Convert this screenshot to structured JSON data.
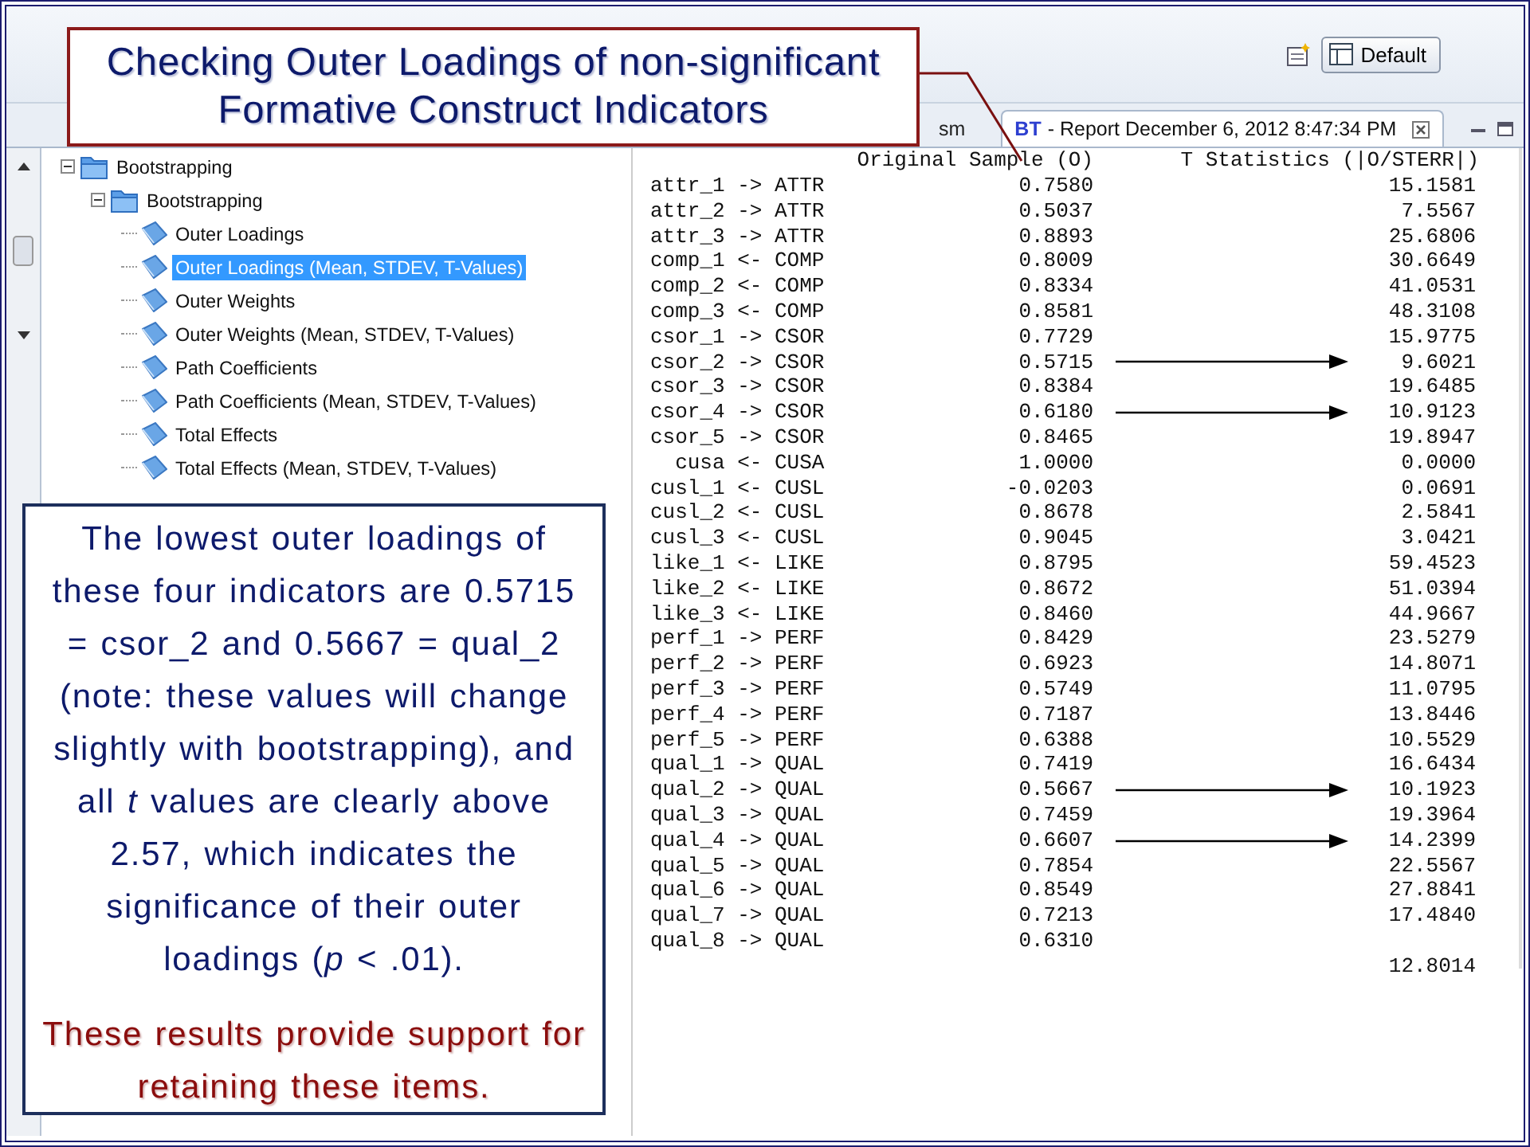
{
  "toolbar": {
    "perspective_button": "Default"
  },
  "tabs": [
    {
      "label": "sm",
      "selected": false
    },
    {
      "icon_label": "BT",
      "label": "- Report December 6, 2012 8:47:34 PM",
      "selected": true
    }
  ],
  "tree": [
    {
      "label": "Bootstrapping",
      "expanded": true,
      "selected": false,
      "children": [
        {
          "label": "Bootstrapping",
          "expanded": true,
          "selected": false,
          "children": [
            {
              "label": "Outer Loadings",
              "selected": false
            },
            {
              "label": "Outer Loadings (Mean, STDEV, T-Values)",
              "selected": true
            },
            {
              "label": "Outer Weights",
              "selected": false
            },
            {
              "label": "Outer Weights (Mean, STDEV, T-Values)",
              "selected": false
            },
            {
              "label": "Path Coefficients",
              "selected": false
            },
            {
              "label": "Path Coefficients (Mean, STDEV, T-Values)",
              "selected": false
            },
            {
              "label": "Total Effects",
              "selected": false
            },
            {
              "label": "Total Effects (Mean, STDEV, T-Values)",
              "selected": false
            }
          ]
        }
      ]
    }
  ],
  "report": {
    "columns": [
      "Original Sample (O)",
      "T Statistics (|O/STERR|)"
    ],
    "rows": [
      {
        "indicator": "attr_1",
        "direction": "->",
        "construct": "ATTR",
        "original_sample": "0.7580",
        "t_statistic": "15.1581",
        "arrow": false
      },
      {
        "indicator": "attr_2",
        "direction": "->",
        "construct": "ATTR",
        "original_sample": "0.5037",
        "t_statistic": "7.5567",
        "arrow": false
      },
      {
        "indicator": "attr_3",
        "direction": "->",
        "construct": "ATTR",
        "original_sample": "0.8893",
        "t_statistic": "25.6806",
        "arrow": false
      },
      {
        "indicator": "comp_1",
        "direction": "<-",
        "construct": "COMP",
        "original_sample": "0.8009",
        "t_statistic": "30.6649",
        "arrow": false
      },
      {
        "indicator": "comp_2",
        "direction": "<-",
        "construct": "COMP",
        "original_sample": "0.8334",
        "t_statistic": "41.0531",
        "arrow": false
      },
      {
        "indicator": "comp_3",
        "direction": "<-",
        "construct": "COMP",
        "original_sample": "0.8581",
        "t_statistic": "48.3108",
        "arrow": false
      },
      {
        "indicator": "csor_1",
        "direction": "->",
        "construct": "CSOR",
        "original_sample": "0.7729",
        "t_statistic": "15.9775",
        "arrow": false
      },
      {
        "indicator": "csor_2",
        "direction": "->",
        "construct": "CSOR",
        "original_sample": "0.5715",
        "t_statistic": "9.6021",
        "arrow": true
      },
      {
        "indicator": "csor_3",
        "direction": "->",
        "construct": "CSOR",
        "original_sample": "0.8384",
        "t_statistic": "19.6485",
        "arrow": false
      },
      {
        "indicator": "csor_4",
        "direction": "->",
        "construct": "CSOR",
        "original_sample": "0.6180",
        "t_statistic": "10.9123",
        "arrow": true
      },
      {
        "indicator": "csor_5",
        "direction": "->",
        "construct": "CSOR",
        "original_sample": "0.8465",
        "t_statistic": "19.8947",
        "arrow": false
      },
      {
        "indicator": "cusa",
        "direction": "<-",
        "construct": "CUSA",
        "original_sample": "1.0000",
        "t_statistic": "0.0000",
        "arrow": false
      },
      {
        "indicator": "cusl_1",
        "direction": "<-",
        "construct": "CUSL",
        "original_sample": "-0.0203",
        "t_statistic": "0.0691",
        "arrow": false
      },
      {
        "indicator": "cusl_2",
        "direction": "<-",
        "construct": "CUSL",
        "original_sample": "0.8678",
        "t_statistic": "2.5841",
        "arrow": false
      },
      {
        "indicator": "cusl_3",
        "direction": "<-",
        "construct": "CUSL",
        "original_sample": "0.9045",
        "t_statistic": "3.0421",
        "arrow": false
      },
      {
        "indicator": "like_1",
        "direction": "<-",
        "construct": "LIKE",
        "original_sample": "0.8795",
        "t_statistic": "59.4523",
        "arrow": false
      },
      {
        "indicator": "like_2",
        "direction": "<-",
        "construct": "LIKE",
        "original_sample": "0.8672",
        "t_statistic": "51.0394",
        "arrow": false
      },
      {
        "indicator": "like_3",
        "direction": "<-",
        "construct": "LIKE",
        "original_sample": "0.8460",
        "t_statistic": "44.9667",
        "arrow": false
      },
      {
        "indicator": "perf_1",
        "direction": "->",
        "construct": "PERF",
        "original_sample": "0.8429",
        "t_statistic": "23.5279",
        "arrow": false
      },
      {
        "indicator": "perf_2",
        "direction": "->",
        "construct": "PERF",
        "original_sample": "0.6923",
        "t_statistic": "14.8071",
        "arrow": false
      },
      {
        "indicator": "perf_3",
        "direction": "->",
        "construct": "PERF",
        "original_sample": "0.5749",
        "t_statistic": "11.0795",
        "arrow": false
      },
      {
        "indicator": "perf_4",
        "direction": "->",
        "construct": "PERF",
        "original_sample": "0.7187",
        "t_statistic": "13.8446",
        "arrow": false
      },
      {
        "indicator": "perf_5",
        "direction": "->",
        "construct": "PERF",
        "original_sample": "0.6388",
        "t_statistic": "10.5529",
        "arrow": false
      },
      {
        "indicator": "qual_1",
        "direction": "->",
        "construct": "QUAL",
        "original_sample": "0.7419",
        "t_statistic": "16.6434",
        "arrow": false
      },
      {
        "indicator": "qual_2",
        "direction": "->",
        "construct": "QUAL",
        "original_sample": "0.5667",
        "t_statistic": "10.1923",
        "arrow": true
      },
      {
        "indicator": "qual_3",
        "direction": "->",
        "construct": "QUAL",
        "original_sample": "0.7459",
        "t_statistic": "19.3964",
        "arrow": false
      },
      {
        "indicator": "qual_4",
        "direction": "->",
        "construct": "QUAL",
        "original_sample": "0.6607",
        "t_statistic": "14.2399",
        "arrow": true
      },
      {
        "indicator": "qual_5",
        "direction": "->",
        "construct": "QUAL",
        "original_sample": "0.7854",
        "t_statistic": "22.5567",
        "arrow": false
      },
      {
        "indicator": "qual_6",
        "direction": "->",
        "construct": "QUAL",
        "original_sample": "0.8549",
        "t_statistic": "27.8841",
        "arrow": false
      },
      {
        "indicator": "qual_7",
        "direction": "->",
        "construct": "QUAL",
        "original_sample": "0.7213",
        "t_statistic": "17.4840",
        "arrow": false
      },
      {
        "indicator": "qual_8",
        "direction": "->",
        "construct": "QUAL",
        "original_sample": "0.6310",
        "t_statistic": "",
        "arrow": false
      },
      {
        "indicator": "",
        "direction": "",
        "construct": "",
        "original_sample": "",
        "t_statistic": "12.8014",
        "arrow": false
      }
    ]
  },
  "title_callout": {
    "text": "Checking Outer Loadings of non-significant Formative Construct Indicators"
  },
  "note_callout": {
    "text": "The lowest outer loadings of these four indicators are 0.5715 = csor_2 and 0.5667 = qual_2 (note: these values will change slightly with bootstrapping), and all *t* values are clearly above 2.57, which indicates the significance of their outer loadings (*p* < .01).",
    "conclusion": "These results provide support for retaining these items."
  }
}
